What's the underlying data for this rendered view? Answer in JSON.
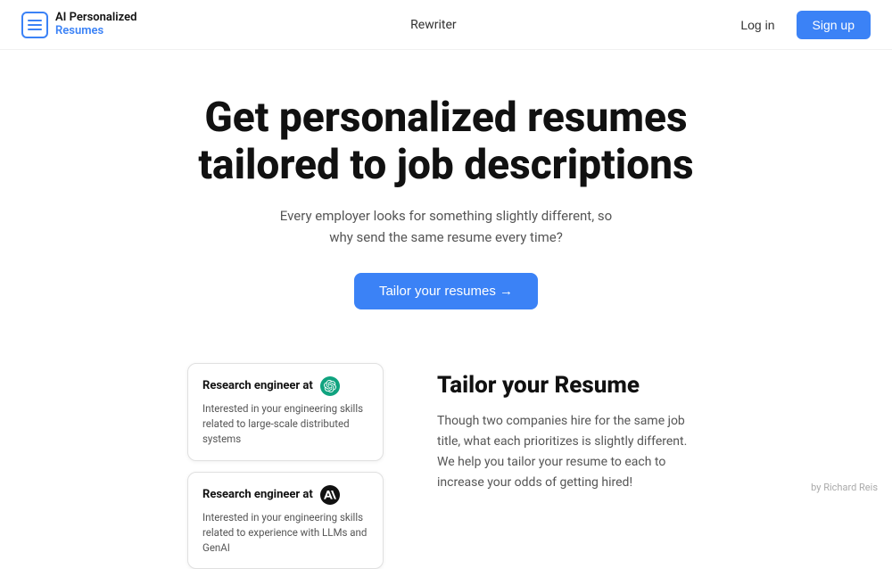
{
  "header": {
    "logo_top": "AI Personalized",
    "logo_bottom": "Resumes",
    "nav": [
      {
        "label": "Rewriter",
        "id": "nav-rewriter"
      }
    ],
    "login_label": "Log in",
    "signup_label": "Sign up"
  },
  "hero": {
    "title": "Get personalized resumes tailored to job descriptions",
    "subtitle": "Every employer looks for something slightly different, so why send the same resume every time?",
    "cta_label": "Tailor your resumes →"
  },
  "features": {
    "section_title": "Tailor your Resume",
    "section_body": "Though two companies hire for the same job title, what each prioritizes is slightly different. We help you tailor your resume to each to increase your odds of getting hired!",
    "cards": [
      {
        "title": "Research engineer at",
        "company_icon": "openai",
        "body": "Interested in your engineering skills related to large-scale distributed systems"
      },
      {
        "title": "Research engineer at",
        "company_icon": "anthropic",
        "body": "Interested in your engineering skills related to experience with LLMs and GenAI"
      }
    ]
  },
  "footer": {
    "credit": "by Richard Reis"
  },
  "icons": {
    "openai_symbol": "✦",
    "anthropic_symbol": "◉",
    "cta_arrow": "→"
  },
  "colors": {
    "brand_blue": "#3b82f6",
    "text_dark": "#111111",
    "text_muted": "#555555",
    "border": "#e0e0e0"
  }
}
